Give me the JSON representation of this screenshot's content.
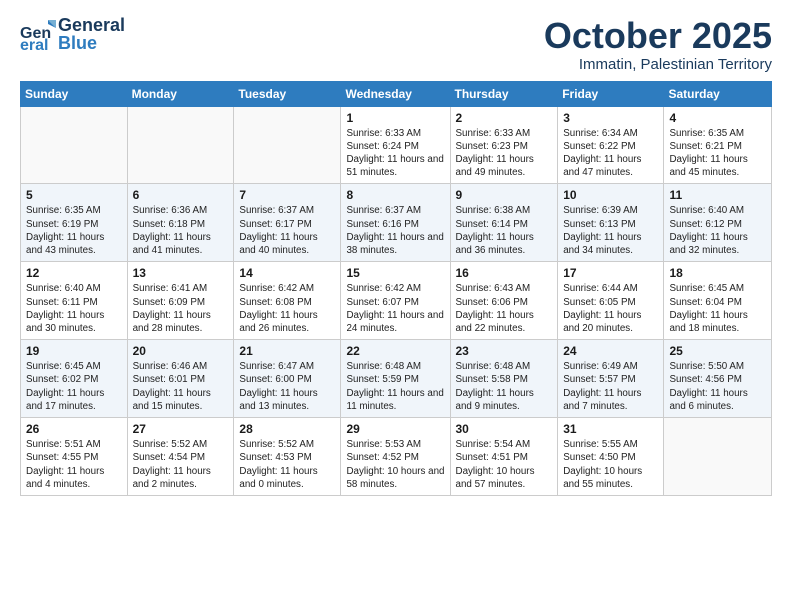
{
  "header": {
    "logo_general": "General",
    "logo_blue": "Blue",
    "month": "October 2025",
    "location": "Immatin, Palestinian Territory"
  },
  "weekdays": [
    "Sunday",
    "Monday",
    "Tuesday",
    "Wednesday",
    "Thursday",
    "Friday",
    "Saturday"
  ],
  "weeks": [
    [
      {
        "day": "",
        "sunrise": "",
        "sunset": "",
        "daylight": ""
      },
      {
        "day": "",
        "sunrise": "",
        "sunset": "",
        "daylight": ""
      },
      {
        "day": "",
        "sunrise": "",
        "sunset": "",
        "daylight": ""
      },
      {
        "day": "1",
        "sunrise": "Sunrise: 6:33 AM",
        "sunset": "Sunset: 6:24 PM",
        "daylight": "Daylight: 11 hours and 51 minutes."
      },
      {
        "day": "2",
        "sunrise": "Sunrise: 6:33 AM",
        "sunset": "Sunset: 6:23 PM",
        "daylight": "Daylight: 11 hours and 49 minutes."
      },
      {
        "day": "3",
        "sunrise": "Sunrise: 6:34 AM",
        "sunset": "Sunset: 6:22 PM",
        "daylight": "Daylight: 11 hours and 47 minutes."
      },
      {
        "day": "4",
        "sunrise": "Sunrise: 6:35 AM",
        "sunset": "Sunset: 6:21 PM",
        "daylight": "Daylight: 11 hours and 45 minutes."
      }
    ],
    [
      {
        "day": "5",
        "sunrise": "Sunrise: 6:35 AM",
        "sunset": "Sunset: 6:19 PM",
        "daylight": "Daylight: 11 hours and 43 minutes."
      },
      {
        "day": "6",
        "sunrise": "Sunrise: 6:36 AM",
        "sunset": "Sunset: 6:18 PM",
        "daylight": "Daylight: 11 hours and 41 minutes."
      },
      {
        "day": "7",
        "sunrise": "Sunrise: 6:37 AM",
        "sunset": "Sunset: 6:17 PM",
        "daylight": "Daylight: 11 hours and 40 minutes."
      },
      {
        "day": "8",
        "sunrise": "Sunrise: 6:37 AM",
        "sunset": "Sunset: 6:16 PM",
        "daylight": "Daylight: 11 hours and 38 minutes."
      },
      {
        "day": "9",
        "sunrise": "Sunrise: 6:38 AM",
        "sunset": "Sunset: 6:14 PM",
        "daylight": "Daylight: 11 hours and 36 minutes."
      },
      {
        "day": "10",
        "sunrise": "Sunrise: 6:39 AM",
        "sunset": "Sunset: 6:13 PM",
        "daylight": "Daylight: 11 hours and 34 minutes."
      },
      {
        "day": "11",
        "sunrise": "Sunrise: 6:40 AM",
        "sunset": "Sunset: 6:12 PM",
        "daylight": "Daylight: 11 hours and 32 minutes."
      }
    ],
    [
      {
        "day": "12",
        "sunrise": "Sunrise: 6:40 AM",
        "sunset": "Sunset: 6:11 PM",
        "daylight": "Daylight: 11 hours and 30 minutes."
      },
      {
        "day": "13",
        "sunrise": "Sunrise: 6:41 AM",
        "sunset": "Sunset: 6:09 PM",
        "daylight": "Daylight: 11 hours and 28 minutes."
      },
      {
        "day": "14",
        "sunrise": "Sunrise: 6:42 AM",
        "sunset": "Sunset: 6:08 PM",
        "daylight": "Daylight: 11 hours and 26 minutes."
      },
      {
        "day": "15",
        "sunrise": "Sunrise: 6:42 AM",
        "sunset": "Sunset: 6:07 PM",
        "daylight": "Daylight: 11 hours and 24 minutes."
      },
      {
        "day": "16",
        "sunrise": "Sunrise: 6:43 AM",
        "sunset": "Sunset: 6:06 PM",
        "daylight": "Daylight: 11 hours and 22 minutes."
      },
      {
        "day": "17",
        "sunrise": "Sunrise: 6:44 AM",
        "sunset": "Sunset: 6:05 PM",
        "daylight": "Daylight: 11 hours and 20 minutes."
      },
      {
        "day": "18",
        "sunrise": "Sunrise: 6:45 AM",
        "sunset": "Sunset: 6:04 PM",
        "daylight": "Daylight: 11 hours and 18 minutes."
      }
    ],
    [
      {
        "day": "19",
        "sunrise": "Sunrise: 6:45 AM",
        "sunset": "Sunset: 6:02 PM",
        "daylight": "Daylight: 11 hours and 17 minutes."
      },
      {
        "day": "20",
        "sunrise": "Sunrise: 6:46 AM",
        "sunset": "Sunset: 6:01 PM",
        "daylight": "Daylight: 11 hours and 15 minutes."
      },
      {
        "day": "21",
        "sunrise": "Sunrise: 6:47 AM",
        "sunset": "Sunset: 6:00 PM",
        "daylight": "Daylight: 11 hours and 13 minutes."
      },
      {
        "day": "22",
        "sunrise": "Sunrise: 6:48 AM",
        "sunset": "Sunset: 5:59 PM",
        "daylight": "Daylight: 11 hours and 11 minutes."
      },
      {
        "day": "23",
        "sunrise": "Sunrise: 6:48 AM",
        "sunset": "Sunset: 5:58 PM",
        "daylight": "Daylight: 11 hours and 9 minutes."
      },
      {
        "day": "24",
        "sunrise": "Sunrise: 6:49 AM",
        "sunset": "Sunset: 5:57 PM",
        "daylight": "Daylight: 11 hours and 7 minutes."
      },
      {
        "day": "25",
        "sunrise": "Sunrise: 5:50 AM",
        "sunset": "Sunset: 4:56 PM",
        "daylight": "Daylight: 11 hours and 6 minutes."
      }
    ],
    [
      {
        "day": "26",
        "sunrise": "Sunrise: 5:51 AM",
        "sunset": "Sunset: 4:55 PM",
        "daylight": "Daylight: 11 hours and 4 minutes."
      },
      {
        "day": "27",
        "sunrise": "Sunrise: 5:52 AM",
        "sunset": "Sunset: 4:54 PM",
        "daylight": "Daylight: 11 hours and 2 minutes."
      },
      {
        "day": "28",
        "sunrise": "Sunrise: 5:52 AM",
        "sunset": "Sunset: 4:53 PM",
        "daylight": "Daylight: 11 hours and 0 minutes."
      },
      {
        "day": "29",
        "sunrise": "Sunrise: 5:53 AM",
        "sunset": "Sunset: 4:52 PM",
        "daylight": "Daylight: 10 hours and 58 minutes."
      },
      {
        "day": "30",
        "sunrise": "Sunrise: 5:54 AM",
        "sunset": "Sunset: 4:51 PM",
        "daylight": "Daylight: 10 hours and 57 minutes."
      },
      {
        "day": "31",
        "sunrise": "Sunrise: 5:55 AM",
        "sunset": "Sunset: 4:50 PM",
        "daylight": "Daylight: 10 hours and 55 minutes."
      },
      {
        "day": "",
        "sunrise": "",
        "sunset": "",
        "daylight": ""
      }
    ]
  ]
}
